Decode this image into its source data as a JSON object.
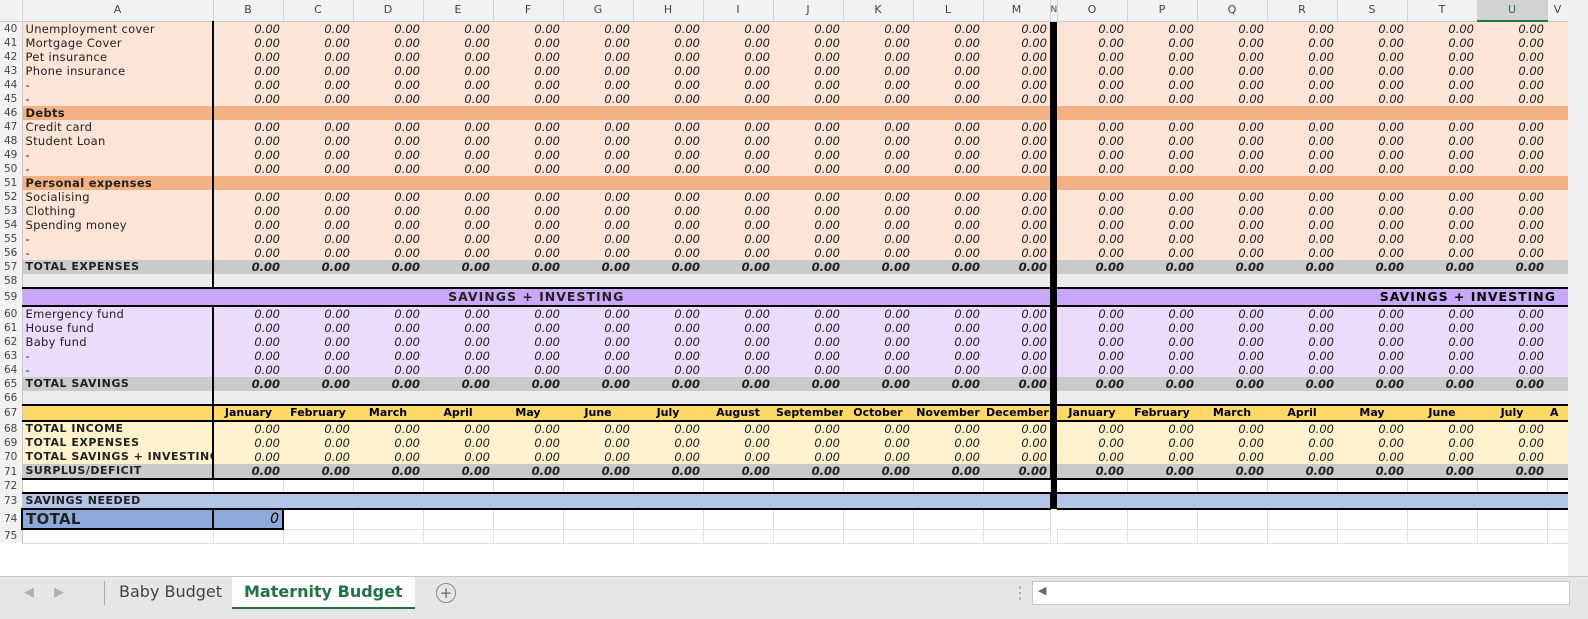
{
  "columns": [
    "A",
    "B",
    "C",
    "D",
    "E",
    "F",
    "G",
    "H",
    "I",
    "J",
    "K",
    "L",
    "M",
    "N",
    "O",
    "P",
    "Q",
    "R",
    "S",
    "T",
    "U",
    "V"
  ],
  "selected_column": "U",
  "months": [
    "January",
    "February",
    "March",
    "April",
    "May",
    "June",
    "July",
    "August",
    "September",
    "October",
    "November",
    "December"
  ],
  "right_months": [
    "January",
    "February",
    "March",
    "April",
    "May",
    "June",
    "July",
    "A"
  ],
  "rows": [
    {
      "n": "40",
      "type": "exp",
      "label": "Unemployment cover",
      "value": "0.00"
    },
    {
      "n": "41",
      "type": "exp",
      "label": "Mortgage Cover",
      "value": "0.00"
    },
    {
      "n": "42",
      "type": "exp",
      "label": "Pet insurance",
      "value": "0.00"
    },
    {
      "n": "43",
      "type": "exp",
      "label": "Phone insurance",
      "value": "0.00"
    },
    {
      "n": "44",
      "type": "exp",
      "label": " -",
      "value": "0.00"
    },
    {
      "n": "45",
      "type": "exp",
      "label": " -",
      "value": "0.00"
    },
    {
      "n": "46",
      "type": "band",
      "label": "Debts"
    },
    {
      "n": "47",
      "type": "exp",
      "label": "Credit card",
      "value": "0.00"
    },
    {
      "n": "48",
      "type": "exp",
      "label": "Student Loan",
      "value": "0.00"
    },
    {
      "n": "49",
      "type": "exp",
      "label": " -",
      "value": "0.00"
    },
    {
      "n": "50",
      "type": "exp",
      "label": " -",
      "value": "0.00"
    },
    {
      "n": "51",
      "type": "band",
      "label": "Personal expenses"
    },
    {
      "n": "52",
      "type": "exp",
      "label": "Socialising",
      "value": "0.00"
    },
    {
      "n": "53",
      "type": "exp",
      "label": "Clothing",
      "value": "0.00"
    },
    {
      "n": "54",
      "type": "exp",
      "label": "Spending money",
      "value": "0.00"
    },
    {
      "n": "55",
      "type": "exp",
      "label": " -",
      "value": "0.00"
    },
    {
      "n": "56",
      "type": "exp",
      "label": " -",
      "value": "0.00"
    },
    {
      "n": "57",
      "type": "texp",
      "label": "TOTAL EXPENSES",
      "value": "0.00"
    },
    {
      "n": "58",
      "type": "gap",
      "label": ""
    },
    {
      "n": "59",
      "type": "savhead",
      "label": "SAVINGS + INVESTING"
    },
    {
      "n": "60",
      "type": "sav",
      "label": "Emergency fund",
      "value": "0.00"
    },
    {
      "n": "61",
      "type": "sav",
      "label": "House fund",
      "value": "0.00"
    },
    {
      "n": "62",
      "type": "sav",
      "label": "Baby fund",
      "value": "0.00"
    },
    {
      "n": "63",
      "type": "sav",
      "label": " -",
      "value": "0.00"
    },
    {
      "n": "64",
      "type": "sav",
      "label": " -",
      "value": "0.00"
    },
    {
      "n": "65",
      "type": "tsav",
      "label": "TOTAL SAVINGS",
      "value": "0.00"
    },
    {
      "n": "66",
      "type": "gap",
      "label": ""
    },
    {
      "n": "67",
      "type": "mhead",
      "label": ""
    },
    {
      "n": "68",
      "type": "summ",
      "label": "TOTAL INCOME",
      "value": "0.00"
    },
    {
      "n": "69",
      "type": "summ",
      "label": "TOTAL EXPENSES",
      "value": "0.00"
    },
    {
      "n": "70",
      "type": "summ",
      "label": "TOTAL SAVINGS + INVESTING",
      "value": "0.00"
    },
    {
      "n": "71",
      "type": "surplus",
      "label": "SURPLUS/DEFICIT",
      "value": "0.00"
    },
    {
      "n": "72",
      "type": "blank",
      "label": ""
    },
    {
      "n": "73",
      "type": "needed",
      "label": "SAVINGS NEEDED"
    },
    {
      "n": "74",
      "type": "total",
      "label": "TOTAL",
      "value": "0"
    },
    {
      "n": "75",
      "type": "empty",
      "label": ""
    }
  ],
  "sheet_tabs": [
    {
      "label": "Baby Budget",
      "active": false
    },
    {
      "label": "Maternity Budget",
      "active": true
    }
  ]
}
